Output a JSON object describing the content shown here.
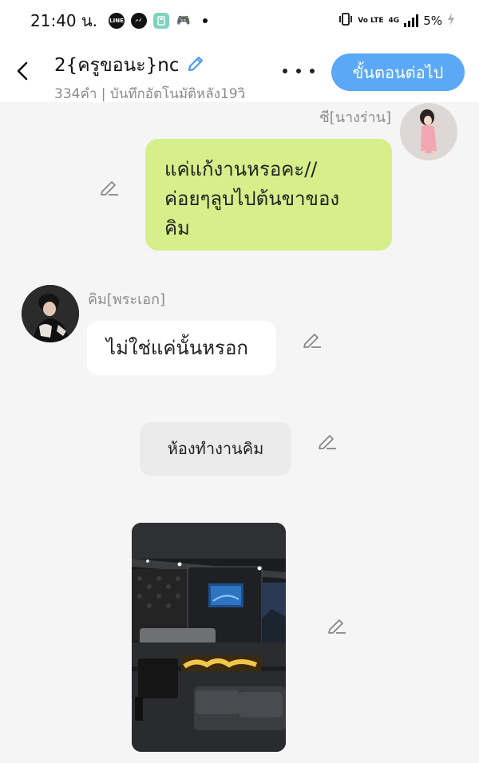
{
  "status_bar": {
    "time": "21:40 น.",
    "apps": [
      "line-icon",
      "messenger-icon",
      "calculator-icon",
      "game-controller-icon"
    ],
    "volte": "Vo LTE",
    "network": "4G",
    "battery": "5%"
  },
  "header": {
    "title": "2{ครูขอนะ}nc",
    "subtitle": "334คำ | บันทึกอัตโนมัติหลัง19วิ",
    "next_button": "ขั้นตอนต่อไป"
  },
  "messages": [
    {
      "sender": "ซี[นางร่าน]",
      "side": "right",
      "text_lines": [
        "แค่แก้งานหรอคะ//",
        "ค่อยๆลูบไปต้นขาของ",
        "คิม"
      ],
      "bubble_color": "#d6ef8a"
    },
    {
      "sender": "คิม[พระเอก]",
      "side": "left",
      "text_lines": [
        "ไม่ใช่แค่นั้นหรอก"
      ],
      "bubble_color": "#ffffff"
    },
    {
      "type": "narration",
      "text": "ห้องทำงานคิม"
    },
    {
      "type": "image",
      "description_icon": "bedroom-image"
    }
  ],
  "colors": {
    "accent": "#5aa8f6",
    "header_bg": "#ffffff",
    "chat_bg": "#f5f5f5"
  }
}
